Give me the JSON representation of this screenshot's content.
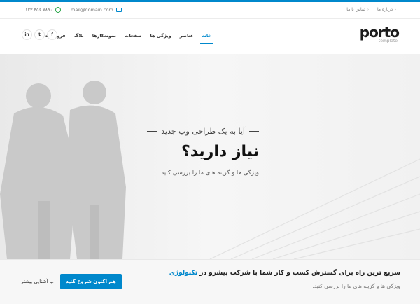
{
  "topbar": {
    "links": [
      "درباره ما",
      "تماس با ما"
    ],
    "email": "mail@domain.com",
    "phone": "۱۲۳ ۴۵۶ ۷۸۹۰"
  },
  "header": {
    "logo_main": "porto",
    "logo_sub": "template",
    "nav": [
      "خانه",
      "عناصر",
      "ویژگی ها",
      "صفحات",
      "نمونه‌کارها",
      "بلاگ",
      "فروشگاه"
    ],
    "social": [
      "f",
      "t",
      "in"
    ]
  },
  "hero": {
    "line1": "آیا به یک طراحی وب جدید",
    "title": "نیاز دارید؟",
    "subtitle": "ویژگی ها و گزینه های ما را بررسی کنید"
  },
  "cta": {
    "heading": "سریع ترین راه برای گسترش کسب و کار شما با شرکت پیشرو در",
    "heading_highlight": "تکنولوژی",
    "subtext": "ویژگی ها و گزینه های ما را بررسی کنید.",
    "button_label": "هم اکنون شروع کنید",
    "more_label": "یا آشنایی بیشتر."
  },
  "colors": {
    "accent": "#0088cc",
    "whatsapp": "#2aa64a"
  }
}
